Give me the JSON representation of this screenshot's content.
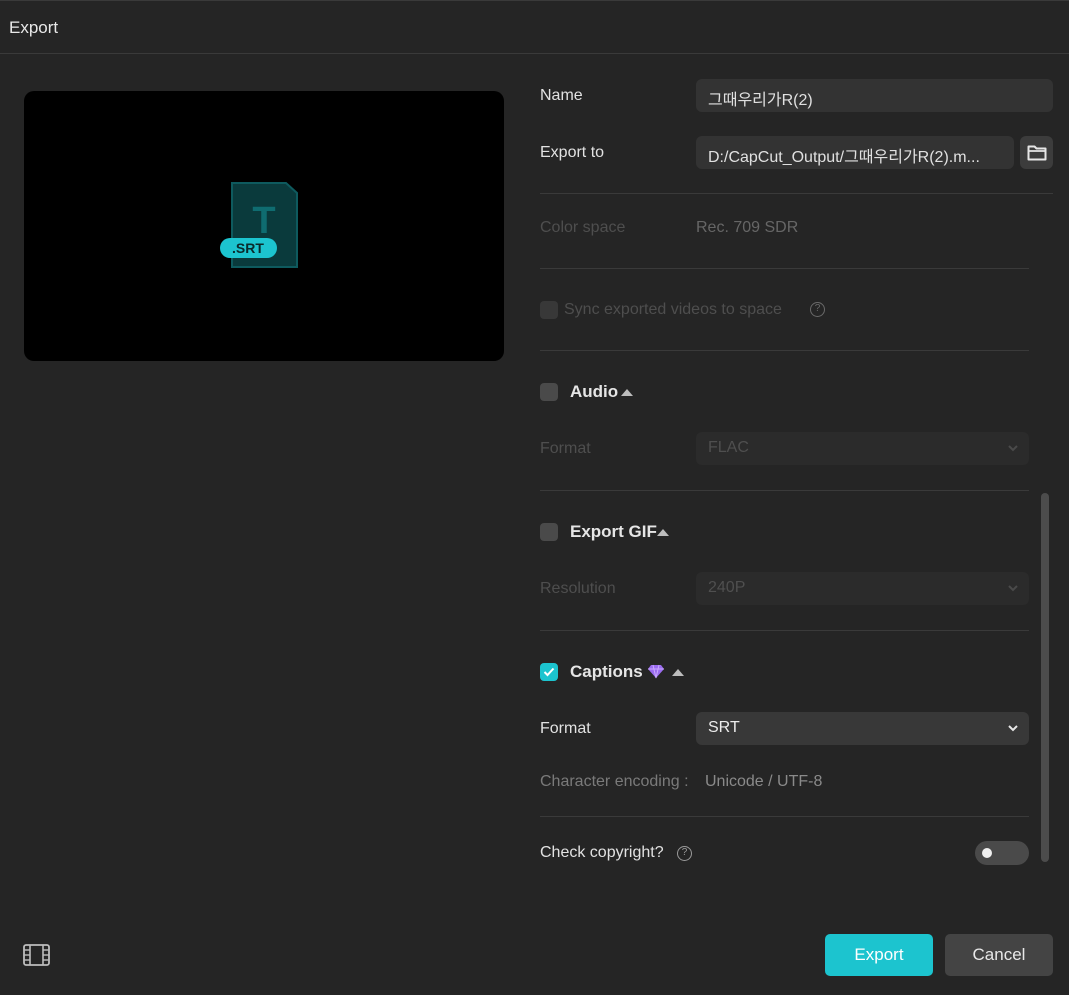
{
  "window": {
    "title": "Export"
  },
  "preview": {
    "file_badge": ".SRT",
    "glyph": "T"
  },
  "name": {
    "label": "Name",
    "value": "그때우리가R(2)"
  },
  "export_to": {
    "label": "Export to",
    "value": "D:/CapCut_Output/그때우리가R(2).m...",
    "folder_icon": "folder-icon"
  },
  "color_space": {
    "label": "Color space",
    "value": "Rec. 709 SDR"
  },
  "sync": {
    "label": "Sync exported videos to space",
    "help": "?"
  },
  "audio": {
    "title": "Audio",
    "checked": false,
    "format_label": "Format",
    "format_value": "FLAC"
  },
  "gif": {
    "title": "Export GIF",
    "checked": false,
    "resolution_label": "Resolution",
    "resolution_value": "240P"
  },
  "captions": {
    "title": "Captions",
    "checked": true,
    "format_label": "Format",
    "format_value": "SRT",
    "encoding_label": "Character encoding :",
    "encoding_value": "Unicode / UTF-8"
  },
  "copyright": {
    "label": "Check copyright?",
    "help": "?",
    "enabled": false
  },
  "footer": {
    "export_label": "Export",
    "cancel_label": "Cancel"
  },
  "colors": {
    "accent": "#1cc4cf",
    "background": "#252525"
  }
}
